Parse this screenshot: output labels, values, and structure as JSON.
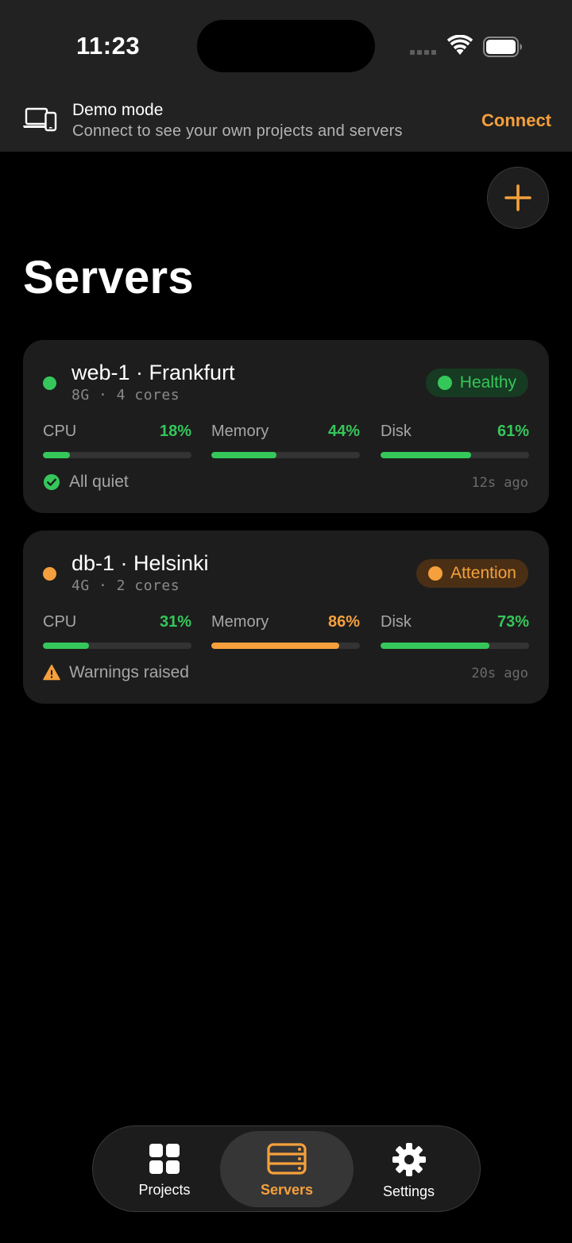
{
  "status_bar": {
    "time": "11:23"
  },
  "demo_banner": {
    "title": "Demo mode",
    "subtitle": "Connect to see your own projects and servers",
    "action": "Connect"
  },
  "page": {
    "title": "Servers"
  },
  "colors": {
    "accent": "#f5a03c",
    "healthy": "#35c75a",
    "attention": "#f5a03c"
  },
  "servers": [
    {
      "name": "web-1 · Frankfurt",
      "spec": "8G · 4 cores",
      "status": "Healthy",
      "status_color": "#35c75a",
      "metrics": [
        {
          "label": "CPU",
          "value": "18%",
          "level": 0.18,
          "color": "#35c75a"
        },
        {
          "label": "Memory",
          "value": "44%",
          "level": 0.44,
          "color": "#35c75a"
        },
        {
          "label": "Disk",
          "value": "61%",
          "level": 0.61,
          "color": "#35c75a"
        }
      ],
      "footer": "All quiet",
      "footer_icon": "check-circle-icon",
      "updated": "12s ago"
    },
    {
      "name": "db-1 · Helsinki",
      "spec": "4G · 2 cores",
      "status": "Attention",
      "status_color": "#f5a03c",
      "metrics": [
        {
          "label": "CPU",
          "value": "31%",
          "level": 0.31,
          "color": "#35c75a"
        },
        {
          "label": "Memory",
          "value": "86%",
          "level": 0.86,
          "color": "#f5a03c"
        },
        {
          "label": "Disk",
          "value": "73%",
          "level": 0.73,
          "color": "#35c75a"
        }
      ],
      "footer": "Warnings raised",
      "footer_icon": "warning-triangle-icon",
      "updated": "20s ago"
    }
  ],
  "tabs": [
    {
      "label": "Projects",
      "icon": "grid-icon",
      "selected": false
    },
    {
      "label": "Servers",
      "icon": "server-icon",
      "selected": true
    },
    {
      "label": "Settings",
      "icon": "gear-icon",
      "selected": false
    }
  ]
}
